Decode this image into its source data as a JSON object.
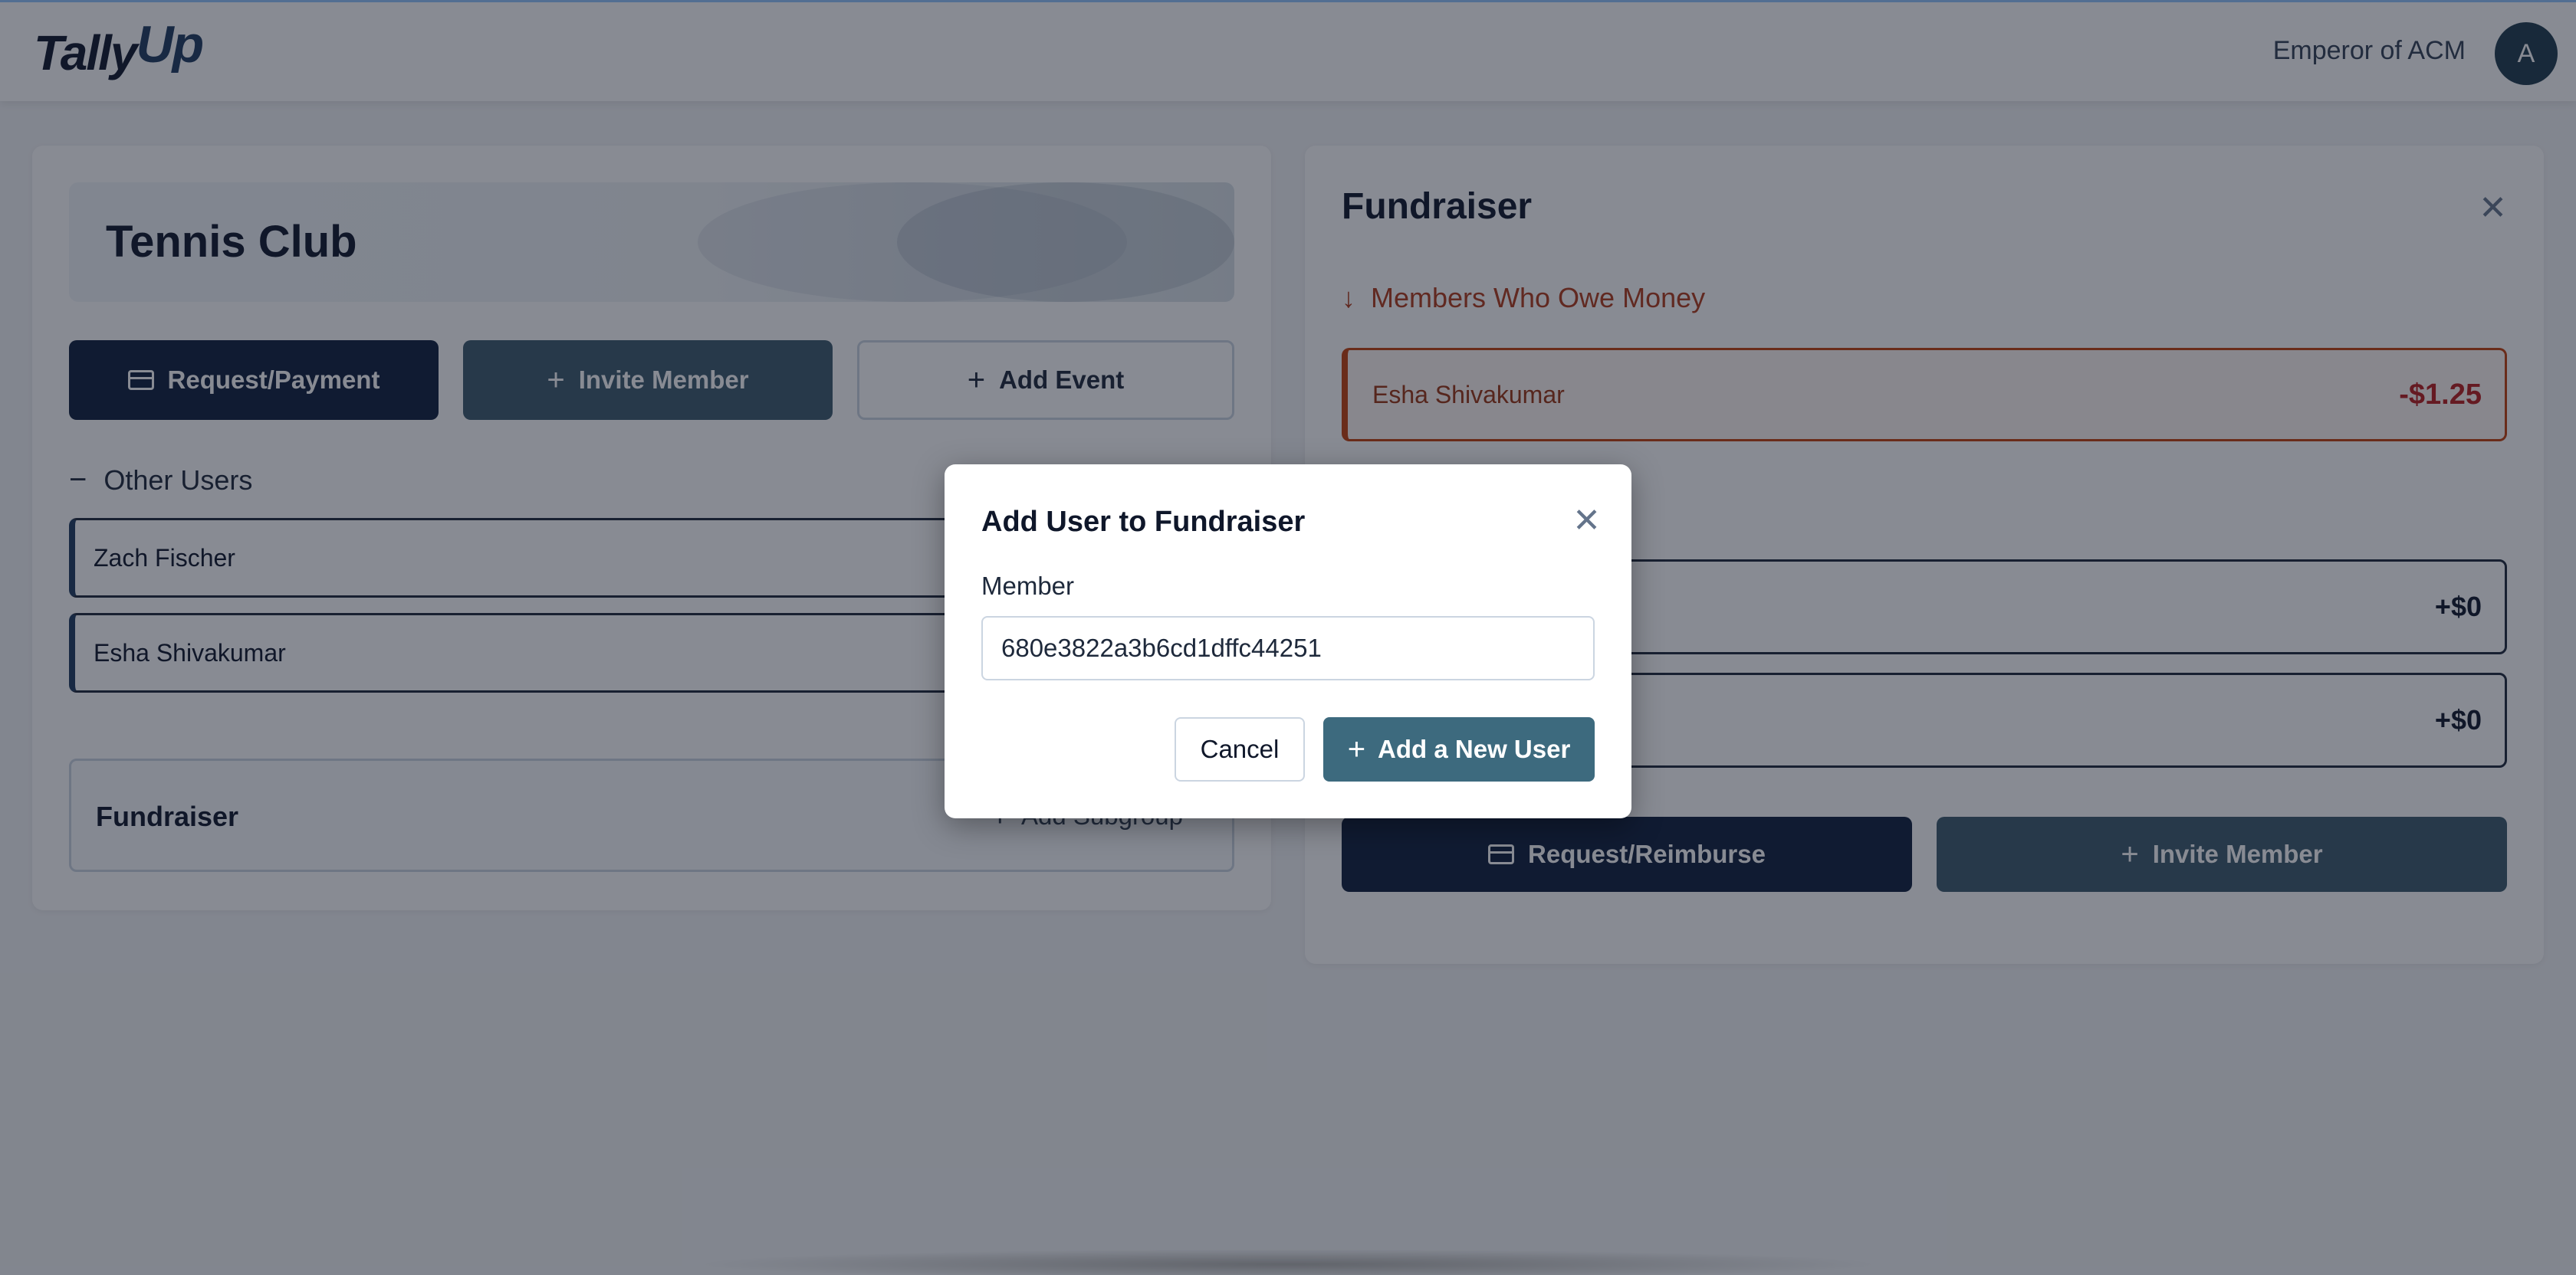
{
  "header": {
    "logo_main": "Tally",
    "logo_accent": "Up",
    "user_name": "Emperor of ACM",
    "avatar_initial": "A"
  },
  "club": {
    "title": "Tennis Club",
    "buttons": {
      "request_payment": "Request/Payment",
      "invite_member": "Invite Member",
      "add_event": "Add Event"
    },
    "other_users_heading": "Other Users",
    "other_users": [
      "Zach Fischer",
      "Esha Shivakumar"
    ],
    "subgroup": {
      "title": "Fundraiser",
      "add_label": "Add Subgroup"
    }
  },
  "fundraiser_panel": {
    "title": "Fundraiser",
    "owe_heading": "Members Who Owe Money",
    "owe_rows": [
      {
        "name": "Esha Shivakumar",
        "amount": "-$1.25"
      }
    ],
    "paid_rows": [
      {
        "amount": "+$0"
      },
      {
        "amount": "+$0"
      }
    ],
    "buttons": {
      "request_reimburse": "Request/Reimburse",
      "invite_member": "Invite Member"
    }
  },
  "modal": {
    "title": "Add User to Fundraiser",
    "member_label": "Member",
    "member_value": "680e3822a3b6cd1dffc44251",
    "cancel_label": "Cancel",
    "add_label": "Add a New User"
  },
  "colors": {
    "primary_dark": "#0f1f3d",
    "teal": "#3d5a6c",
    "owe_accent": "#c2410c"
  }
}
